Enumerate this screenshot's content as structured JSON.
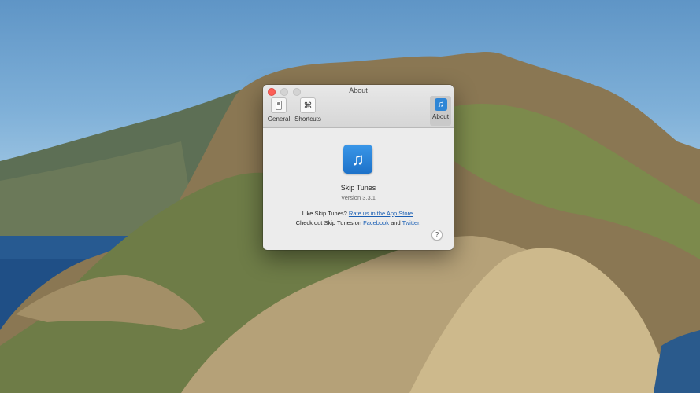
{
  "window": {
    "title": "About"
  },
  "toolbar": {
    "general_label": "General",
    "shortcuts_label": "Shortcuts",
    "about_label": "About",
    "general_icon": "switch-icon",
    "shortcuts_icon": "command-icon",
    "about_icon": "music-note-icon"
  },
  "about": {
    "app_icon": "music-note-icon",
    "app_name": "Skip Tunes",
    "version": "Version 3.3.1",
    "like_prefix": "Like Skip Tunes?",
    "rate_link": "Rate us in the App Store",
    "like_suffix": ".",
    "checkout_prefix": "Check out Skip Tunes on",
    "facebook_link": "Facebook",
    "and_text": "and",
    "twitter_link": "Twitter",
    "checkout_suffix": ".",
    "help_glyph": "?"
  },
  "colors": {
    "close_button": "#fc5f57",
    "accent": "#2f86d6",
    "link": "#1a5fb4"
  }
}
